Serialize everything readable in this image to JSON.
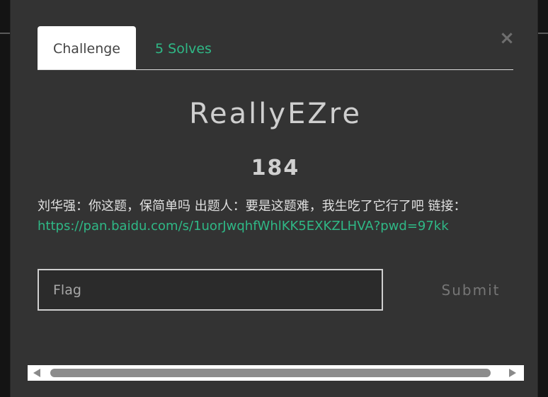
{
  "modal": {
    "close_label": "×",
    "tabs": [
      {
        "label": "Challenge"
      },
      {
        "label": "5 Solves"
      }
    ],
    "challenge_name": "ReallyEZre",
    "challenge_value": "184",
    "description_text": "刘华强：你这题，保简单吗 出题人：要是这题难，我生吃了它行了吧 链接：",
    "description_link": "https://pan.baidu.com/s/1uorJwqhfWhlKK5EXKZLHVA?pwd=97kk",
    "flag_placeholder": "Flag",
    "submit_label": "Submit"
  },
  "colors": {
    "accent": "#2fb886",
    "modal_bg": "#333333",
    "backdrop": "#141414"
  }
}
